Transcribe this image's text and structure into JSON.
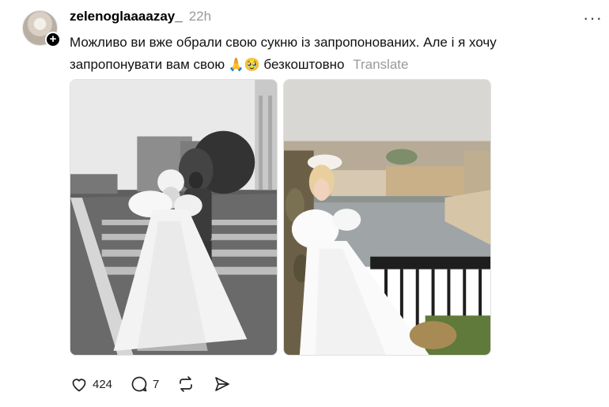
{
  "post": {
    "username": "zelenoglaaaazay_",
    "time": "22h",
    "caption_text": "Можливо ви вже обрали свою сукню із запропонованих. Але і я хочу запропонувати вам свою",
    "caption_emoji": "🙏🥹",
    "caption_tail": "безкоштовно",
    "translate_label": "Translate",
    "more_icon": "···",
    "follow_icon": "+",
    "images": [
      {
        "name": "wedding-photo-bw-street"
      },
      {
        "name": "wedding-photo-color-embankment"
      }
    ],
    "actions": {
      "likes": "424",
      "comments": "7"
    }
  }
}
